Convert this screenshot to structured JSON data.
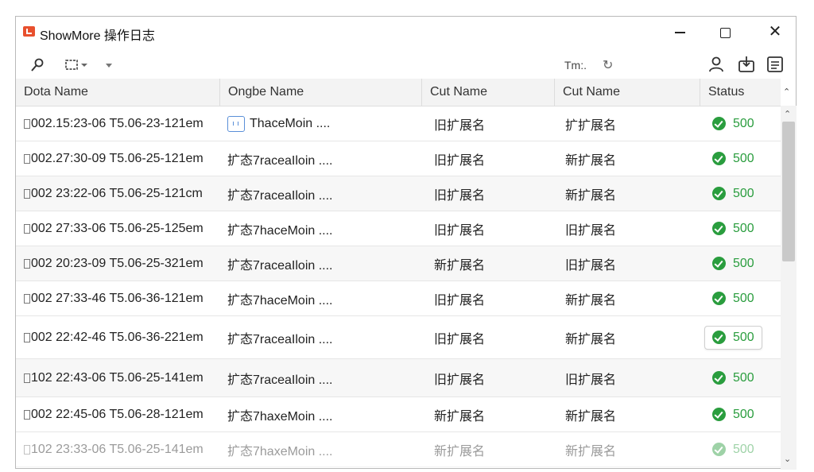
{
  "window": {
    "title": "ShowMore  操作日志",
    "controls": {
      "minimize": "minimize",
      "maximize": "maximize",
      "close": "✕"
    }
  },
  "toolbar": {
    "search_icon": "magnifier-icon",
    "filter_icon": "filter-icon",
    "time_label": "Tm:.",
    "refresh_icon": "↻"
  },
  "columns": [
    "Dota Name",
    "Ongbe Name",
    "Cut Name",
    "Cut Name",
    "Status"
  ],
  "rows": [
    {
      "date": "002.15:23-06 T5.06-23-121em",
      "orig": "ThaceMoin ....",
      "cut1": "旧扩展名",
      "cut2": "扩扩展名",
      "status": "500"
    },
    {
      "date": "002.27:30-09 T5.06-25-121em",
      "orig": "扩态7raceaIloin ....",
      "cut1": "旧扩展名",
      "cut2": "新扩展名",
      "status": "500"
    },
    {
      "date": "002 23:22-06 T5.06-25-121cm",
      "orig": "扩态7raceaIloin ....",
      "cut1": "旧扩展名",
      "cut2": "新扩展名",
      "status": "500"
    },
    {
      "date": "002 27:33-06 T5.06-25-125em",
      "orig": "扩态7haceMoin ....",
      "cut1": "旧扩展名",
      "cut2": "旧扩展名",
      "status": "500"
    },
    {
      "date": "002 20:23-09 T5.06-25-321em",
      "orig": "扩态7raceaIloin ....",
      "cut1": "新扩展名",
      "cut2": "旧扩展名",
      "status": "500"
    },
    {
      "date": "002 27:33-46 T5.06-36-121em",
      "orig": "扩态7haceMoin ....",
      "cut1": "旧扩展名",
      "cut2": "新扩展名",
      "status": "500"
    },
    {
      "date": "002 22:42-46 T5.06-36-221em",
      "orig": "扩态7raceaIloin ....",
      "cut1": "旧扩展名",
      "cut2": "新扩展名",
      "status": "500"
    },
    {
      "date": "102 22:43-06 T5.06-25-141em",
      "orig": "扩态7raceaIloin ....",
      "cut1": "旧扩展名",
      "cut2": "旧扩展名",
      "status": "500"
    },
    {
      "date": "002 22:45-06 T5.06-28-121em",
      "orig": "扩态7haxeMoin ....",
      "cut1": "新扩展名",
      "cut2": "新扩展名",
      "status": "500"
    },
    {
      "date": "102 23:33-06 T5.06-25-141em",
      "orig": "扩态7haxeMoin ....",
      "cut1": "新扩展名",
      "cut2": "新扩展名",
      "status": "500"
    }
  ],
  "colors": {
    "status_green": "#2a9d3e",
    "app_icon": "#e8502e"
  }
}
